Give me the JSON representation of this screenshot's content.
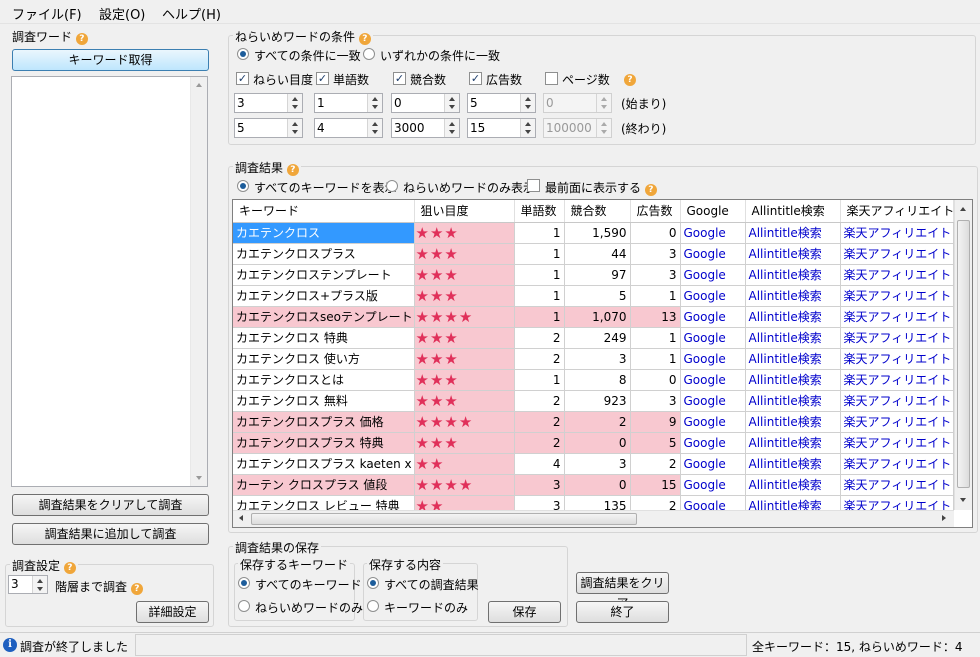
{
  "menu": {
    "file": "ファイル(F)",
    "settings": "設定(O)",
    "help": "ヘルプ(H)"
  },
  "left": {
    "title": "調査ワード",
    "get_keywords_button": "キーワード取得",
    "clear_and_search_button": "調査結果をクリアして調査",
    "add_and_search_button": "調査結果に追加して調査",
    "settings_title": "調査設定",
    "depth_value": "3",
    "depth_label": "階層まで調査",
    "detail_button": "詳細設定"
  },
  "conditions": {
    "title": "ねらいめワードの条件",
    "match_all": "すべての条件に一致",
    "match_any": "いずれかの条件に一致",
    "checks": [
      {
        "label": "ねらい目度",
        "checked": true,
        "start": "3",
        "end": "5"
      },
      {
        "label": "単語数",
        "checked": true,
        "start": "1",
        "end": "4"
      },
      {
        "label": "競合数",
        "checked": true,
        "start": "0",
        "end": "3000"
      },
      {
        "label": "広告数",
        "checked": true,
        "start": "5",
        "end": "15"
      },
      {
        "label": "ページ数",
        "checked": false,
        "start": "0",
        "end": "100000"
      }
    ],
    "start_label": "(始まり)",
    "end_label": "(終わり)"
  },
  "results": {
    "title": "調査結果",
    "show_all": "すべてのキーワードを表示",
    "show_target": "ねらいめワードのみ表示",
    "topmost": "最前面に表示する",
    "columns": [
      "キーワード",
      "狙い目度",
      "単語数",
      "競合数",
      "広告数",
      "Google",
      "Allintitle検索",
      "楽天アフィリエイト"
    ],
    "rows": [
      {
        "kw": "カエテンクロス",
        "stars": "★★★",
        "words": "1",
        "comp": "1,590",
        "ads": "0",
        "g": "Google",
        "a": "Allintitle検索",
        "r": "楽天アフィリエイト",
        "hl": false
      },
      {
        "kw": "カエテンクロスプラス",
        "stars": "★★★",
        "words": "1",
        "comp": "44",
        "ads": "3",
        "g": "Google",
        "a": "Allintitle検索",
        "r": "楽天アフィリエイト",
        "hl": false
      },
      {
        "kw": "カエテンクロステンプレート",
        "stars": "★★★",
        "words": "1",
        "comp": "97",
        "ads": "3",
        "g": "Google",
        "a": "Allintitle検索",
        "r": "楽天アフィリエイト",
        "hl": false
      },
      {
        "kw": "カエテンクロス+プラス版",
        "stars": "★★★",
        "words": "1",
        "comp": "5",
        "ads": "1",
        "g": "Google",
        "a": "Allintitle検索",
        "r": "楽天アフィリエイト",
        "hl": false
      },
      {
        "kw": "カエテンクロスseoテンプレート",
        "stars": "★★★★",
        "words": "1",
        "comp": "1,070",
        "ads": "13",
        "g": "Google",
        "a": "Allintitle検索",
        "r": "楽天アフィリエイト",
        "hl": true
      },
      {
        "kw": "カエテンクロス 特典",
        "stars": "★★★",
        "words": "2",
        "comp": "249",
        "ads": "1",
        "g": "Google",
        "a": "Allintitle検索",
        "r": "楽天アフィリエイト",
        "hl": false
      },
      {
        "kw": "カエテンクロス 使い方",
        "stars": "★★★",
        "words": "2",
        "comp": "3",
        "ads": "1",
        "g": "Google",
        "a": "Allintitle検索",
        "r": "楽天アフィリエイト",
        "hl": false
      },
      {
        "kw": "カエテンクロスとは",
        "stars": "★★★",
        "words": "1",
        "comp": "8",
        "ads": "0",
        "g": "Google",
        "a": "Allintitle検索",
        "r": "楽天アフィリエイト",
        "hl": false
      },
      {
        "kw": "カエテンクロス 無料",
        "stars": "★★★",
        "words": "2",
        "comp": "923",
        "ads": "3",
        "g": "Google",
        "a": "Allintitle検索",
        "r": "楽天アフィリエイト",
        "hl": false
      },
      {
        "kw": "カエテンクロスプラス 価格",
        "stars": "★★★★",
        "words": "2",
        "comp": "2",
        "ads": "9",
        "g": "Google",
        "a": "Allintitle検索",
        "r": "楽天アフィリエイト",
        "hl": true
      },
      {
        "kw": "カエテンクロスプラス 特典",
        "stars": "★★★",
        "words": "2",
        "comp": "0",
        "ads": "5",
        "g": "Google",
        "a": "Allintitle検索",
        "r": "楽天アフィリエイト",
        "hl": true
      },
      {
        "kw": "カエテンクロスプラス kaeten x plus",
        "stars": "★★",
        "words": "4",
        "comp": "3",
        "ads": "2",
        "g": "Google",
        "a": "Allintitle検索",
        "r": "楽天アフィリエイト",
        "hl": false
      },
      {
        "kw": "カーテン クロスプラス 値段",
        "stars": "★★★★",
        "words": "3",
        "comp": "0",
        "ads": "15",
        "g": "Google",
        "a": "Allintitle検索",
        "r": "楽天アフィリエイト",
        "hl": true
      },
      {
        "kw": "カエテンクロス レビュー 特典",
        "stars": "★★",
        "words": "3",
        "comp": "135",
        "ads": "2",
        "g": "Google",
        "a": "Allintitle検索",
        "r": "楽天アフィリエイト",
        "hl": false
      }
    ]
  },
  "save": {
    "title": "調査結果の保存",
    "kw_group": "保存するキーワード",
    "kw_all": "すべてのキーワード",
    "kw_target": "ねらいめワードのみ",
    "content_group": "保存する内容",
    "content_all": "すべての調査結果",
    "content_kw": "キーワードのみ",
    "save_button": "保存",
    "clear_button": "調査結果をクリア",
    "exit_button": "終了"
  },
  "status": {
    "message": "調査が終了しました",
    "summary": "全キーワード：15, ねらいめワード：4"
  }
}
